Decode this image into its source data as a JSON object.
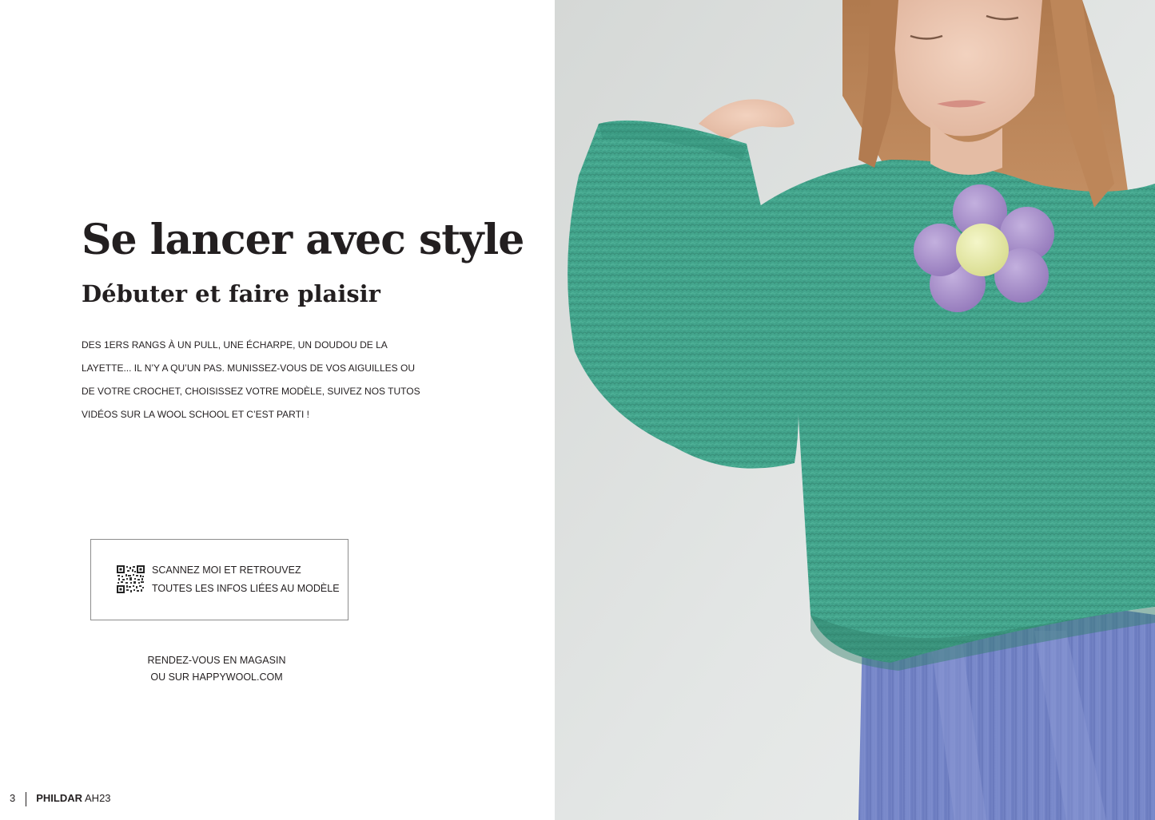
{
  "spread": {
    "title": "Se lancer avec style",
    "subtitle": "Débuter et faire plaisir",
    "intro_lines": [
      "DES 1ERS RANGS À UN PULL, UNE ÉCHARPE, UN DOUDOU DE LA",
      "LAYETTE... IL N’Y A QU’UN PAS. MUNISSEZ-VOUS DE VOS AIGUILLES OU",
      "DE VOTRE CROCHET, CHOISISSEZ VOTRE MODÈLE, SUIVEZ NOS TUTOS",
      "VIDÉOS SUR LA WOOL SCHOOL ET C’EST PARTI !"
    ]
  },
  "qr_box": {
    "line1": "SCANNEZ MOI ET RETROUVEZ",
    "line2": "TOUTES LES INFOS LIÉES AU MODÈLE",
    "icon": "qr-code-icon"
  },
  "store_notice": {
    "line1": "RENDEZ-VOUS EN MAGASIN",
    "line2": "OU SUR HAPPYWOOL.COM"
  },
  "footer": {
    "page_number": "3",
    "brand": "PHILDAR",
    "season": "AH23"
  },
  "photo": {
    "subject": "child-wearing-green-knit-sweater-with-flower-pompom-brooch"
  },
  "colors": {
    "text": "#231f20",
    "sweater": "#3fa58c",
    "pompom_purple": "#a98fca",
    "pompom_yellow": "#e9ecaa",
    "dress_blue": "#7787c8",
    "background_gray": "#dfe2e1"
  }
}
